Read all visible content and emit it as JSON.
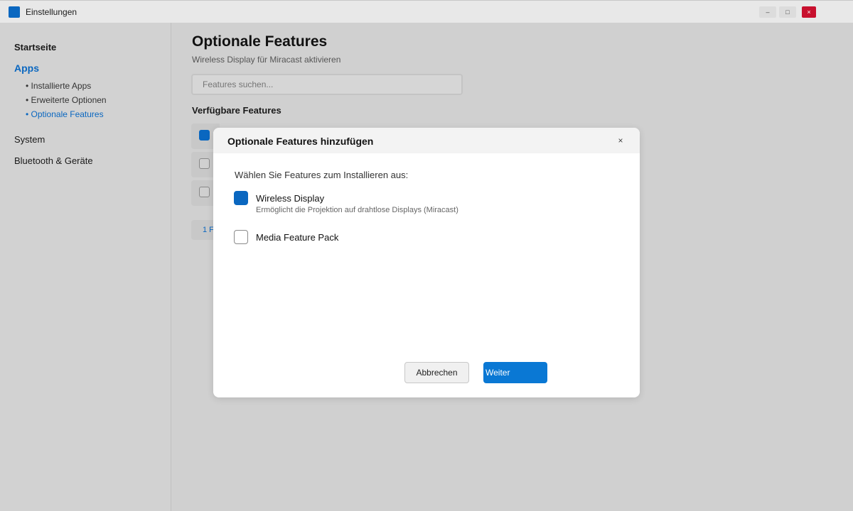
{
  "window": {
    "title": "Einstellungen",
    "minimize_glyph": "–",
    "maximize_glyph": "□",
    "close_glyph": "×"
  },
  "sidebar": {
    "home": "Startseite",
    "apps": "Apps",
    "apps_sub": [
      {
        "label": "• Installierte Apps",
        "active": false
      },
      {
        "label": "• Erweiterte Optionen",
        "active": false
      },
      {
        "label": "• Optionale Features",
        "active": true
      }
    ],
    "system": "System",
    "bluetooth": "Bluetooth & Geräte"
  },
  "main": {
    "title": "Optionale Features",
    "subtitle": "Wireless Display für Miracast aktivieren",
    "search_placeholder": "Features suchen...",
    "section_title": "Verfügbare Features",
    "background_rows": [
      {
        "checked": true
      },
      {
        "checked": false
      },
      {
        "checked": false
      }
    ],
    "count_visible": "1 F"
  },
  "dialog": {
    "title": "Optionale Features hinzufügen",
    "close_glyph": "×",
    "prompt": "Wählen Sie Features zum Installieren aus:",
    "features": [
      {
        "label": "Wireless Display",
        "description": "Ermöglicht die Projektion auf drahtlose Displays (Miracast)",
        "checked": true
      },
      {
        "label": "Media Feature Pack",
        "description": "",
        "checked": false
      }
    ],
    "cancel_label": "Abbrechen",
    "next_label": "Weiter"
  },
  "colors": {
    "accent": "#0a67c0",
    "primary_button": "#0a78d4",
    "close_button": "#c8102e"
  }
}
